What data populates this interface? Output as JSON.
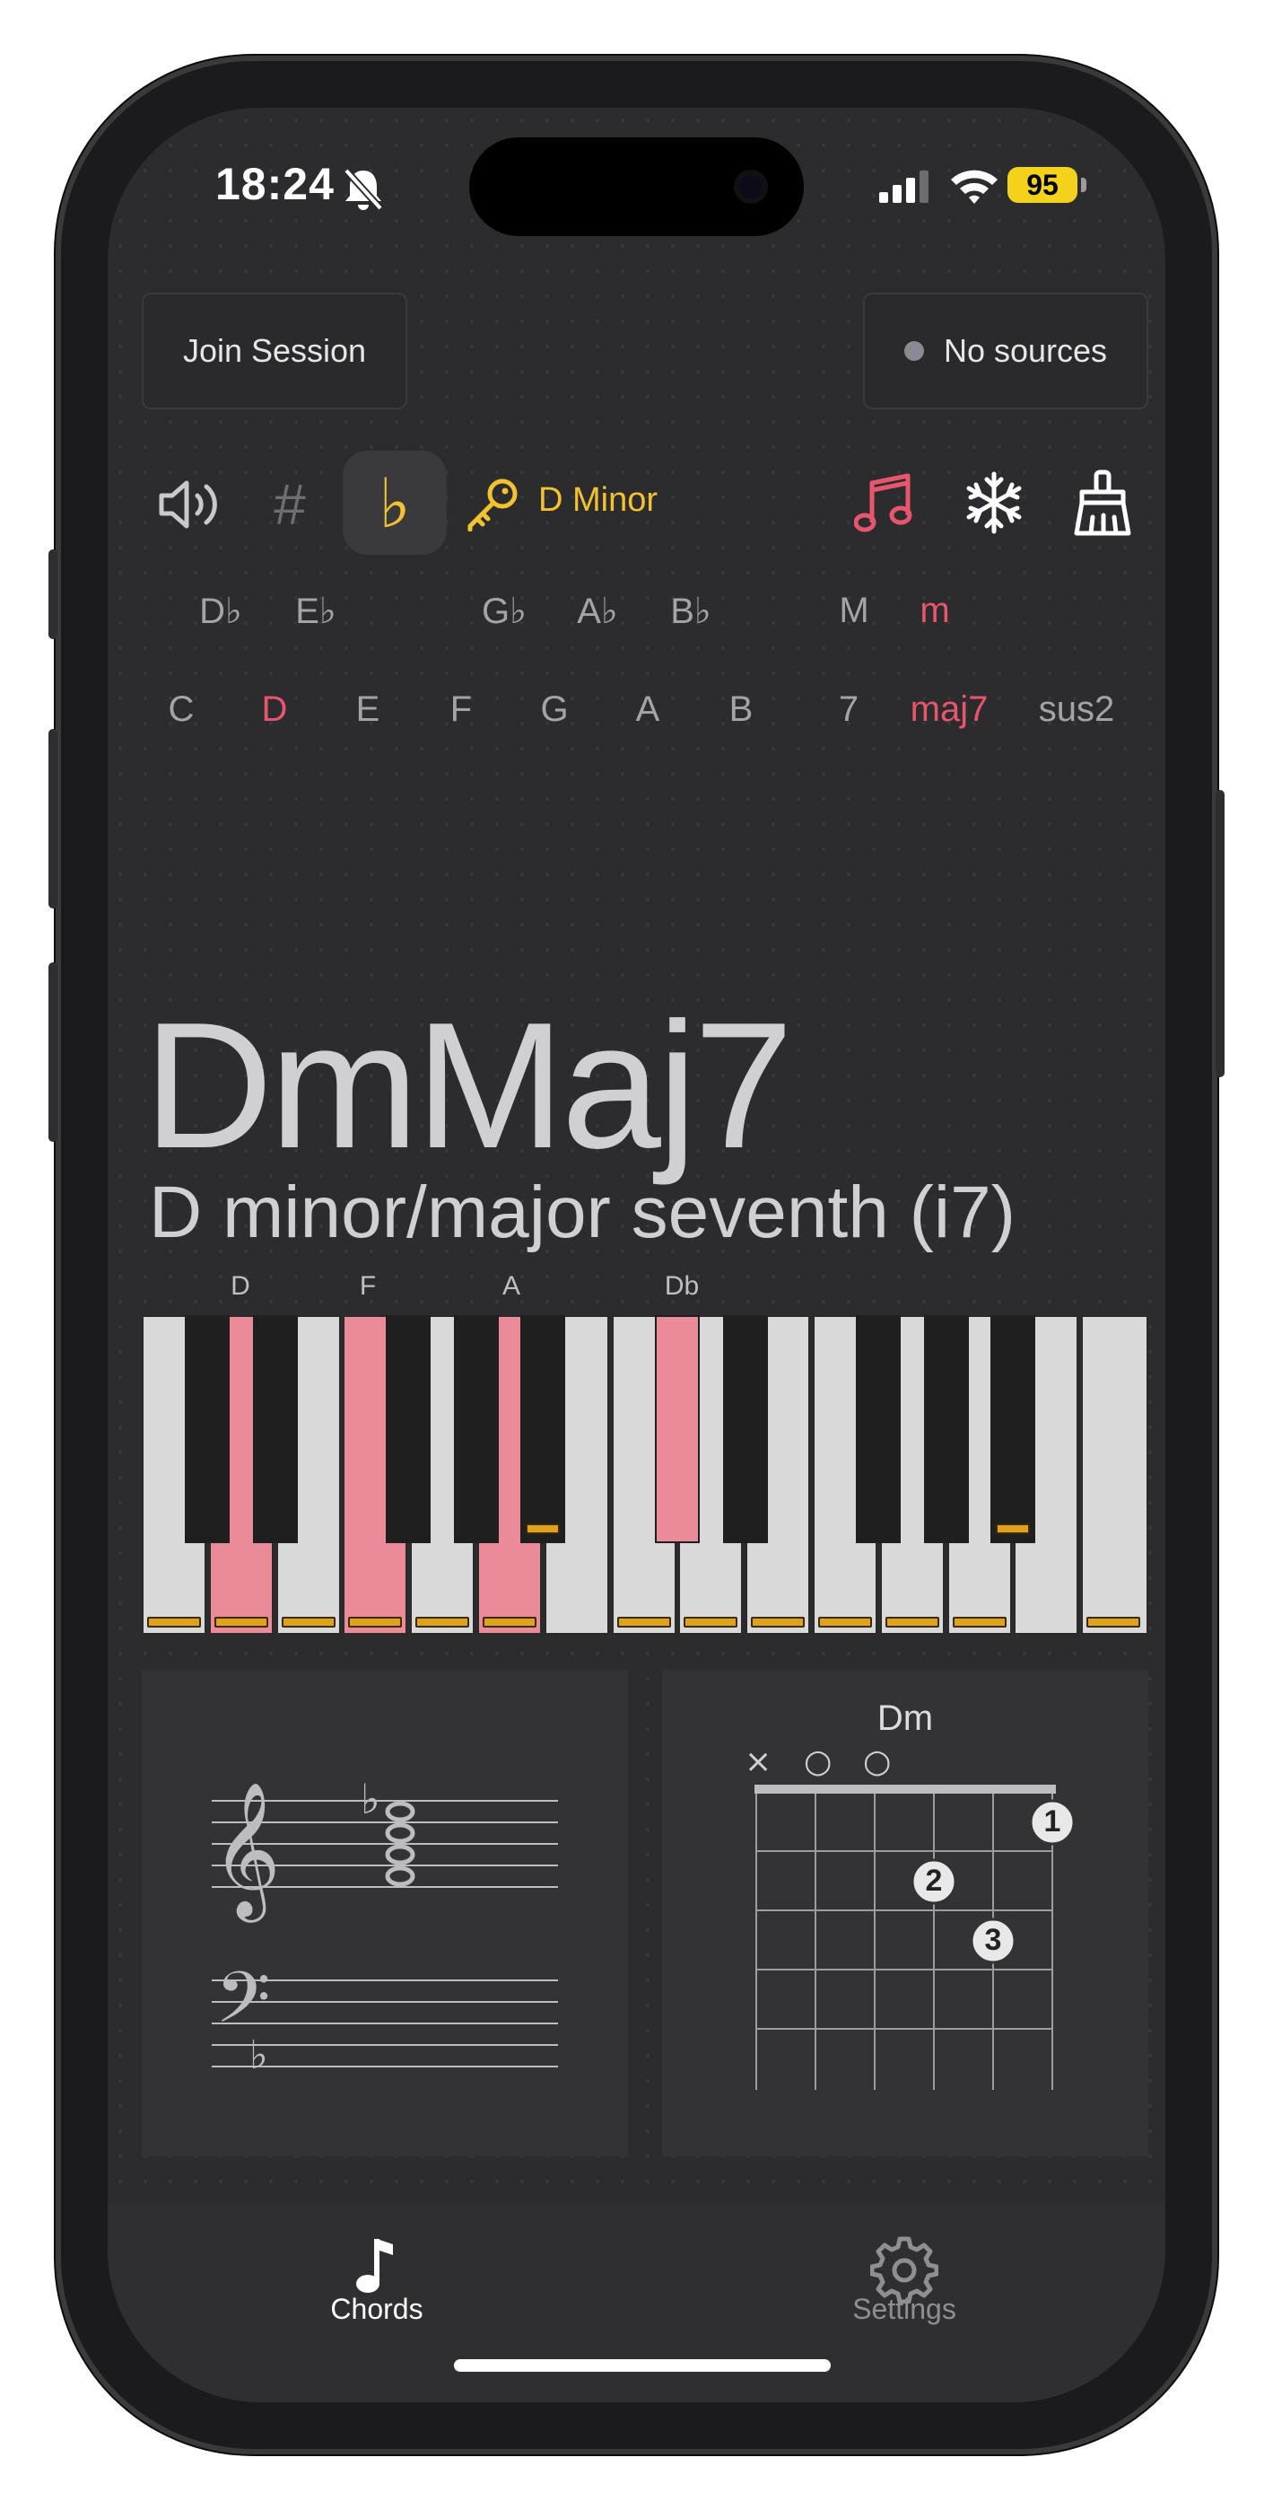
{
  "status": {
    "time": "18:24",
    "battery": "95"
  },
  "header": {
    "join_label": "Join Session",
    "sources_label": "No sources"
  },
  "toolbar": {
    "key_label": "D Minor",
    "sharp_symbol": "#",
    "flat_symbol": "♭",
    "accent_color": "#f2c230",
    "highlight_color": "#e8566e"
  },
  "accidentals": [
    "D♭",
    "E♭",
    "G♭",
    "A♭",
    "B♭"
  ],
  "naturals": [
    "C",
    "D",
    "E",
    "F",
    "G",
    "A",
    "B"
  ],
  "qualities_top": [
    "M",
    "m"
  ],
  "qualities_bottom": [
    "7",
    "maj7",
    "sus2"
  ],
  "selected": {
    "root": "D",
    "quality": "m",
    "extension": "maj7"
  },
  "chord": {
    "name": "DmMaj7",
    "description": "D minor/major seventh (i7)"
  },
  "piano": {
    "labels": [
      "D",
      "F",
      "A",
      "Db"
    ],
    "highlighted_white": [
      "D",
      "F",
      "A"
    ],
    "highlighted_black": [
      "C#/Db"
    ]
  },
  "guitar": {
    "chord": "Dm",
    "string_marks": [
      "×",
      "○",
      "○"
    ],
    "fingers": [
      "1",
      "2",
      "3"
    ]
  },
  "tabs": [
    {
      "label": "Chords",
      "icon": "music-note-icon",
      "active": true
    },
    {
      "label": "Settings",
      "icon": "gear-icon",
      "active": false
    }
  ]
}
